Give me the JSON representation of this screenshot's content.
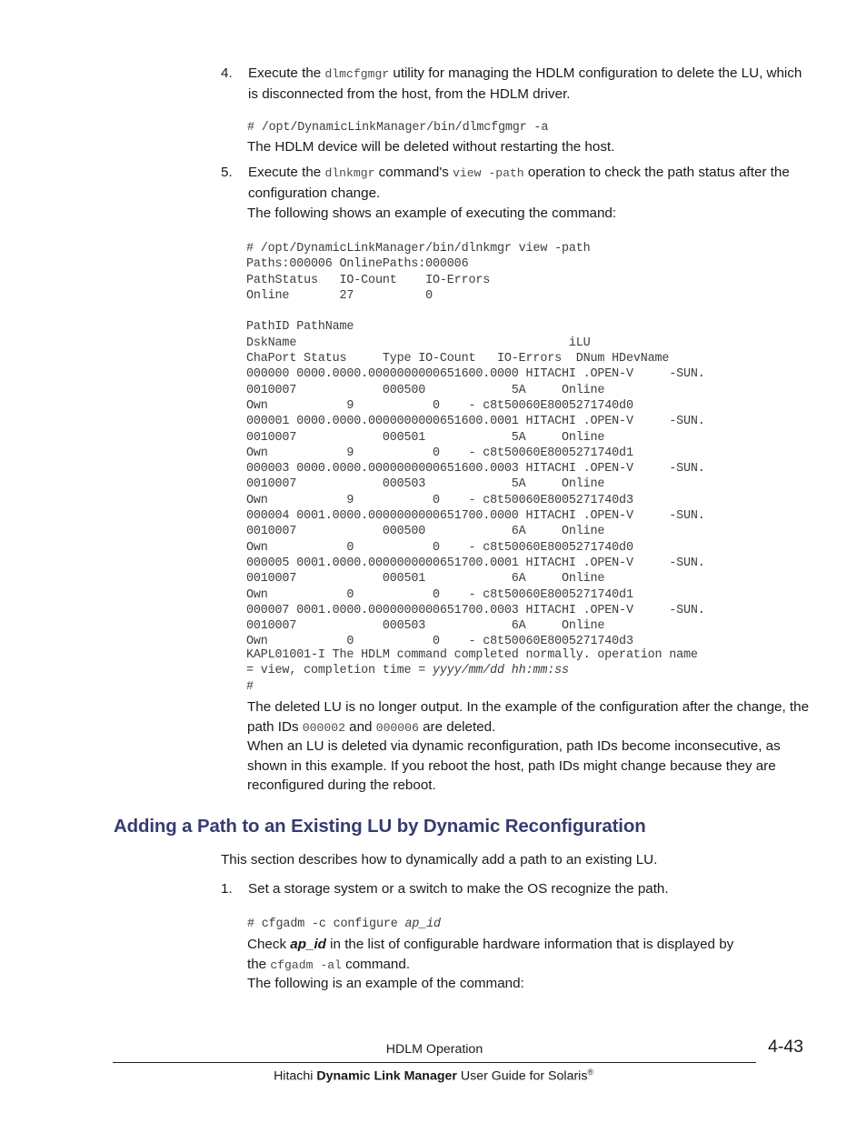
{
  "steps": [
    {
      "number": "4.",
      "text_before": "Execute the ",
      "code1": "dlmcfgmgr",
      "text_after": " utility for managing the HDLM configuration to delete the LU, which is disconnected from the host, from the HDLM driver."
    },
    {
      "number": "5.",
      "text_before": "Execute the ",
      "code1": "dlnkmgr",
      "text_mid": " command's ",
      "code2": "view -path",
      "text_after": " operation to check the path status after the configuration change."
    }
  ],
  "step4_command": "# /opt/DynamicLinkManager/bin/dlmcfgmgr -a",
  "step4_result": "The HDLM device will be deleted without restarting the host.",
  "step5_follow": "The following shows an example of executing the command:",
  "terminal_output": {
    "lines": [
      "# /opt/DynamicLinkManager/bin/dlnkmgr view -path",
      "Paths:000006 OnlinePaths:000006",
      "PathStatus   IO-Count    IO-Errors",
      "Online       27          0",
      "",
      "PathID PathName",
      "DskName                                      iLU",
      "ChaPort Status     Type IO-Count   IO-Errors  DNum HDevName",
      "000000 0000.0000.0000000000651600.0000 HITACHI .OPEN-V     -SUN.",
      "0010007            000500            5A     Online",
      "Own           9           0    - c8t50060E8005271740d0",
      "000001 0000.0000.0000000000651600.0001 HITACHI .OPEN-V     -SUN.",
      "0010007            000501            5A     Online",
      "Own           9           0    - c8t50060E8005271740d1",
      "000003 0000.0000.0000000000651600.0003 HITACHI .OPEN-V     -SUN.",
      "0010007            000503            5A     Online",
      "Own           9           0    - c8t50060E8005271740d3",
      "000004 0001.0000.0000000000651700.0000 HITACHI .OPEN-V     -SUN.",
      "0010007            000500            6A     Online",
      "Own           0           0    - c8t50060E8005271740d0",
      "000005 0001.0000.0000000000651700.0001 HITACHI .OPEN-V     -SUN.",
      "0010007            000501            6A     Online",
      "Own           0           0    - c8t50060E8005271740d1",
      "000007 0001.0000.0000000000651700.0003 HITACHI .OPEN-V     -SUN.",
      "0010007            000503            6A     Online",
      "Own           0           0    - c8t50060E8005271740d3"
    ],
    "kapl_line1": "KAPL01001-I The HDLM command completed normally. operation name",
    "kapl_line2_a": "= view, completion time = ",
    "kapl_line2_italic": "yyyy/mm/dd hh:mm:ss",
    "kapl_prompt": "#"
  },
  "paragraphs": {
    "deleted_lu_a": "The deleted LU is no longer output. In the example of the configuration after the change, the path IDs ",
    "deleted_lu_code1": "000002",
    "deleted_lu_b": " and ",
    "deleted_lu_code2": "000006",
    "deleted_lu_c": " are deleted.",
    "inconsecutive": "When an LU is deleted via dynamic reconfiguration, path IDs become inconsecutive, as shown in this example. If you reboot the host, path IDs might change because they are reconfigured during the reboot."
  },
  "section": {
    "heading": "Adding a Path to an Existing LU by Dynamic Reconfiguration",
    "intro": "This section describes how to dynamically add a path to an existing LU.",
    "step1_number": "1.",
    "step1_text": "Set a storage system or a switch to make the OS recognize the path.",
    "step1_command": "# cfgadm -c configure ",
    "step1_command_italic": "ap_id",
    "check_a": "Check ",
    "check_italic": "ap_id",
    "check_b": " in the list of configurable hardware information that is displayed by the ",
    "check_code": "cfgadm -al",
    "check_c": " command.",
    "following": "The following is an example of the command:"
  },
  "footer": {
    "center_text": "HDLM Operation",
    "page_number": "4-43",
    "guide_prefix": "Hitachi ",
    "guide_bold": "Dynamic Link Manager",
    "guide_suffix": " User Guide for Solaris",
    "registered_mark": "®"
  }
}
